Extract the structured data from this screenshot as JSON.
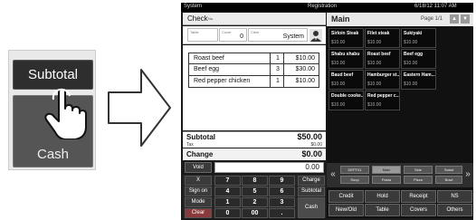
{
  "zoom": {
    "subtotal_label": "Subtotal",
    "cash_label": "Cash",
    "hand_icon": "pointing-hand-icon",
    "arrow_icon": "right-arrow-icon"
  },
  "status_bar": {
    "left": "System",
    "center": "Registration",
    "right": "6/18/12 11:07 AM"
  },
  "check": {
    "title": "Check",
    "no_label": "No.",
    "table_label": "Table",
    "cover_label": "Cover",
    "cover_value": "0",
    "clerk_label": "Clerk",
    "clerk_value": "System"
  },
  "items": [
    {
      "name": "Roast beef",
      "qty": "1",
      "amount": "$10.00"
    },
    {
      "name": "Beef egg",
      "qty": "3",
      "amount": "$30.00"
    },
    {
      "name": "Red pepper chicken",
      "qty": "1",
      "amount": "$10.00"
    }
  ],
  "totals": {
    "subtotal_label": "Subtotal",
    "subtotal_value": "$50.00",
    "tax_label": "Tax",
    "tax_value": "$0.00",
    "change_label": "Change",
    "change_value": "$0.00"
  },
  "entry": {
    "void_label": "Void",
    "value": "0.00"
  },
  "keypad": {
    "x": "X",
    "sign_on": "Sign on",
    "mode": "Mode",
    "clear": "Clear",
    "k7": "7",
    "k8": "8",
    "k9": "9",
    "k4": "4",
    "k5": "5",
    "k6": "6",
    "k1": "1",
    "k2": "2",
    "k3": "3",
    "k0": "0",
    "k00": "00",
    "dot": ".",
    "charge": "Charge",
    "subtotal": "Subtotal",
    "cash": "Cash"
  },
  "menu": {
    "title": "Main",
    "page": "Page 1/1",
    "items": [
      {
        "name": "Sirloin Steak",
        "price": "$10.00"
      },
      {
        "name": "Filet steak",
        "price": "$10.00"
      },
      {
        "name": "Sukiyaki",
        "price": "$10.00"
      },
      {
        "name": "Shabu shabu",
        "price": "$10.00"
      },
      {
        "name": "Roast beef",
        "price": "$10.00"
      },
      {
        "name": "Beef egg",
        "price": "$10.00"
      },
      {
        "name": "Baud beef",
        "price": "$10.00"
      },
      {
        "name": "Hamburger st...",
        "price": "$10.00"
      },
      {
        "name": "Eastern Ham...",
        "price": "$10.00"
      },
      {
        "name": "Double cooke...",
        "price": "$10.00"
      },
      {
        "name": "Red pepper c...",
        "price": "$10.00"
      }
    ]
  },
  "categories": {
    "row1": [
      "DEPT01",
      "Main",
      "Side",
      "Salad"
    ],
    "row2": [
      "Soup",
      "Pasta",
      "Pizza",
      "Bowl"
    ],
    "active": "Main"
  },
  "functions": {
    "row1": [
      "Credit",
      "Hold",
      "Receipt",
      "NS"
    ],
    "row2": [
      "New/Old",
      "Table",
      "Covers",
      "Others"
    ]
  }
}
